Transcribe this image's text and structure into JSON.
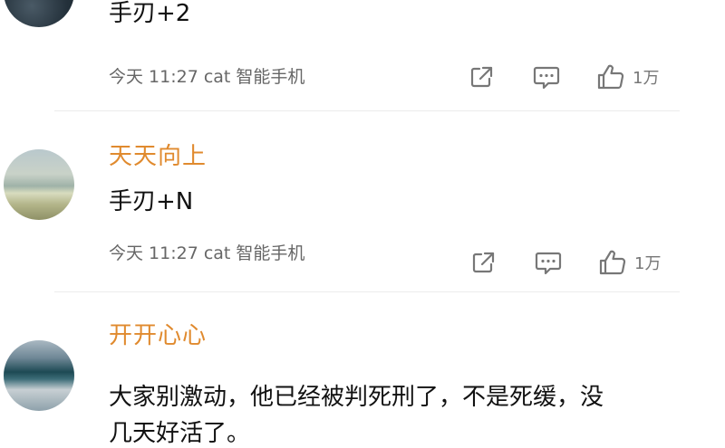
{
  "comments": [
    {
      "username": "",
      "content": "手刃+2",
      "meta": "今天 11:27 cat 智能手机",
      "likes": "1万"
    },
    {
      "username": "天天向上",
      "content": "手刃+N",
      "meta": "今天 11:27 cat 智能手机",
      "likes": "1万"
    },
    {
      "username": "开开心心",
      "content": "大家别激动，他已经被判死刑了，不是死缓，没",
      "content_line2": "几天好活了。"
    }
  ],
  "icons": {
    "share": "share-icon",
    "reply": "comment-icon",
    "like": "thumbs-up-icon"
  },
  "colors": {
    "username": "#e08a2e",
    "text": "#111111",
    "meta": "#666666",
    "icon": "#777777",
    "divider": "#ececec"
  }
}
